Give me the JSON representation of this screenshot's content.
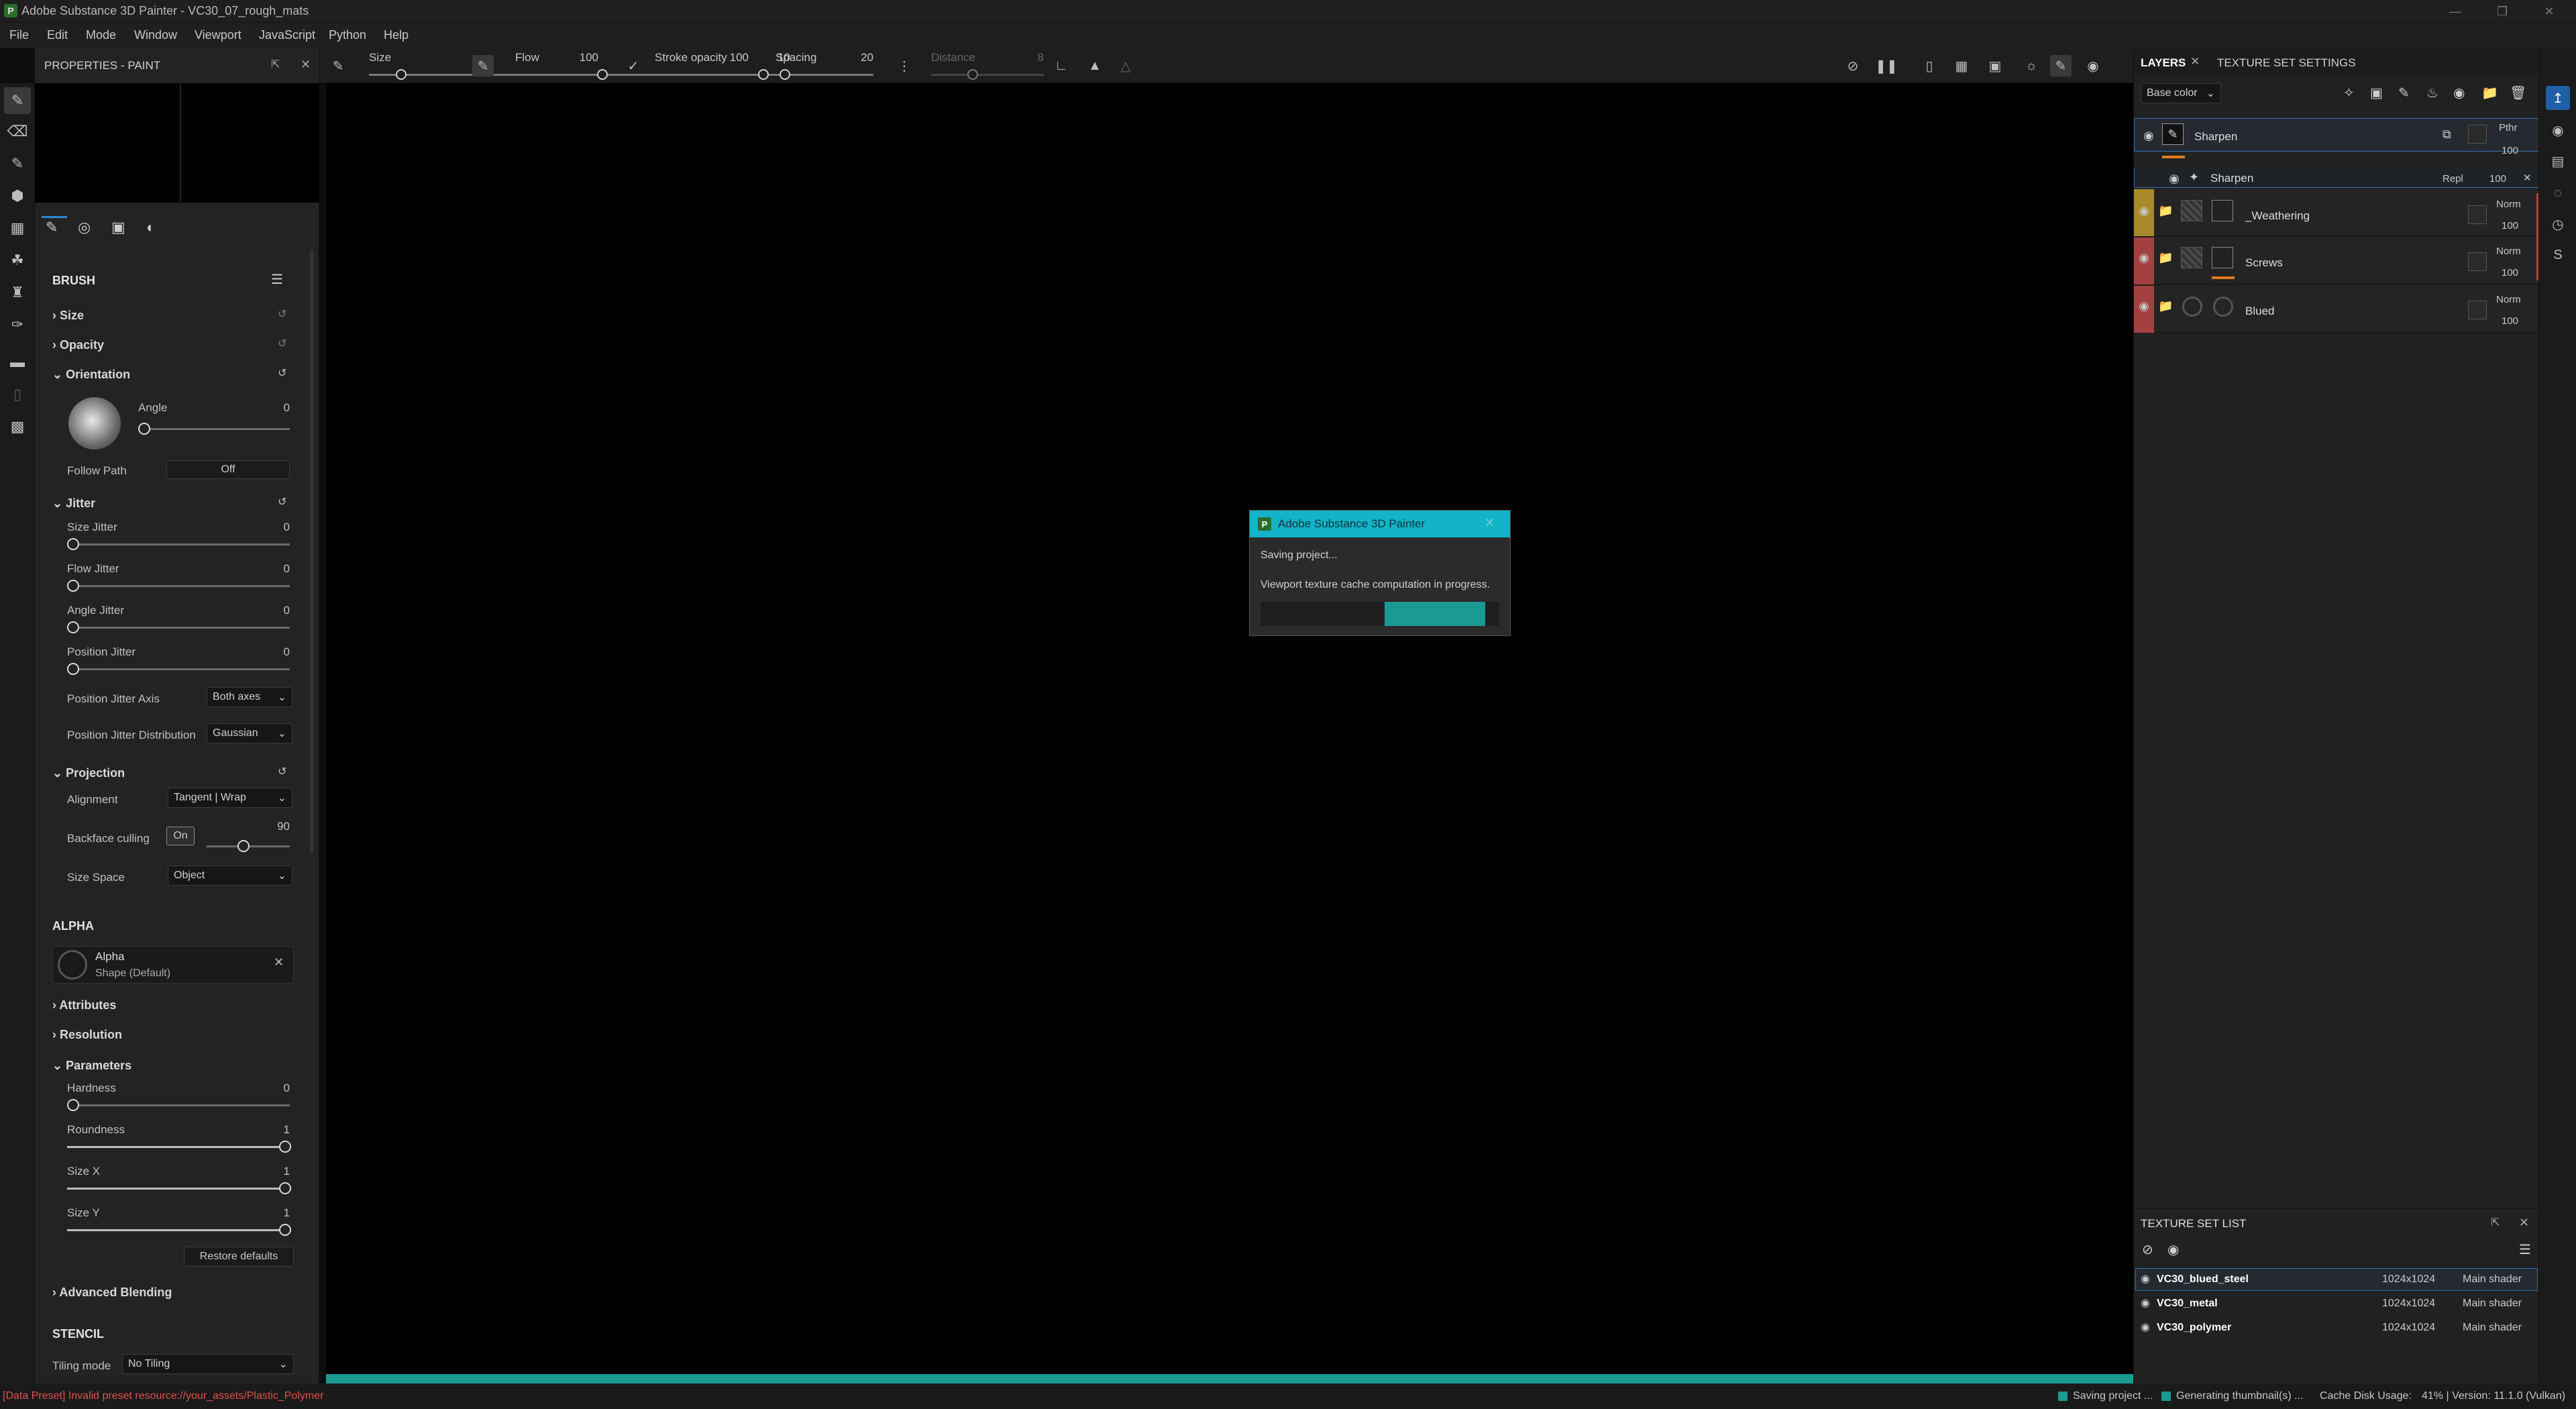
{
  "window": {
    "title": "Adobe Substance 3D Painter - VC30_07_rough_mats"
  },
  "menu": [
    "File",
    "Edit",
    "Mode",
    "Window",
    "Viewport",
    "JavaScript",
    "Python",
    "Help"
  ],
  "toolbar": {
    "size_label": "Size",
    "size_value": "10",
    "flow_label": "Flow",
    "flow_value": "100",
    "stroke_opacity_label": "Stroke opacity",
    "stroke_opacity_value": "100",
    "spacing_label": "Spacing",
    "spacing_value": "20",
    "distance_label": "Distance",
    "distance_value": "8"
  },
  "properties": {
    "title": "PROPERTIES - PAINT",
    "brush_header": "BRUSH",
    "size": "Size",
    "opacity": "Opacity",
    "orientation": "Orientation",
    "angle_label": "Angle",
    "angle_value": "0",
    "follow_path_label": "Follow Path",
    "follow_path_value": "Off",
    "jitter": "Jitter",
    "size_jitter_label": "Size Jitter",
    "size_jitter_value": "0",
    "flow_jitter_label": "Flow Jitter",
    "flow_jitter_value": "0",
    "angle_jitter_label": "Angle Jitter",
    "angle_jitter_value": "0",
    "position_jitter_label": "Position Jitter",
    "position_jitter_value": "0",
    "position_jitter_axis_label": "Position Jitter Axis",
    "position_jitter_axis_value": "Both axes",
    "position_jitter_distribution_label": "Position Jitter Distribution",
    "position_jitter_distribution_value": "Gaussian",
    "projection": "Projection",
    "alignment_label": "Alignment",
    "alignment_value": "Tangent | Wrap",
    "backface_label": "Backface culling",
    "backface_value": "On",
    "backface_angle": "90",
    "size_space_label": "Size Space",
    "size_space_value": "Object",
    "alpha_header": "ALPHA",
    "alpha_name": "Alpha",
    "alpha_sub": "Shape (Default)",
    "attributes": "Attributes",
    "resolution": "Resolution",
    "parameters": "Parameters",
    "hardness_label": "Hardness",
    "hardness_value": "0",
    "roundness_label": "Roundness",
    "roundness_value": "1",
    "sizex_label": "Size X",
    "sizex_value": "1",
    "sizey_label": "Size Y",
    "sizey_value": "1",
    "restore_defaults": "Restore defaults",
    "advanced_blending": "Advanced Blending",
    "stencil_header": "STENCIL",
    "tiling_label": "Tiling mode",
    "tiling_value": "No Tiling"
  },
  "dialog": {
    "title": "Adobe Substance 3D Painter",
    "line1": "Saving project...",
    "line2": "Viewport texture cache computation in progress.",
    "progress": 0.52
  },
  "layers": {
    "tab_layers": "LAYERS",
    "tab_texture_set": "TEXTURE SET SETTINGS",
    "channel": "Base color",
    "items": [
      {
        "name": "Sharpen",
        "blend": "Pthr",
        "opacity": "100"
      },
      {
        "name": "Sharpen",
        "blend": "Repl",
        "opacity": "100"
      },
      {
        "name": "_Weathering",
        "blend": "Norm",
        "opacity": "100"
      },
      {
        "name": "Screws",
        "blend": "Norm",
        "opacity": "100"
      },
      {
        "name": "Blued",
        "blend": "Norm",
        "opacity": "100"
      }
    ]
  },
  "texture_sets": {
    "title": "TEXTURE SET LIST",
    "items": [
      {
        "name": "VC30_blued_steel",
        "res": "1024x1024",
        "shader": "Main shader"
      },
      {
        "name": "VC30_metal",
        "res": "1024x1024",
        "shader": "Main shader"
      },
      {
        "name": "VC30_polymer",
        "res": "1024x1024",
        "shader": "Main shader"
      }
    ]
  },
  "status": {
    "error": "[Data Preset] Invalid preset resource://your_assets/Plastic_Polymer",
    "saving": "Saving project ...",
    "generating": "Generating thumbnail(s) ...",
    "cache": "Cache Disk Usage:",
    "cache_value": "41% | Version: 11.1.0 (Vulkan)"
  },
  "colors": {
    "accent": "#1a9a92",
    "dialog_header": "#13b3c8",
    "error": "#e0524a"
  }
}
